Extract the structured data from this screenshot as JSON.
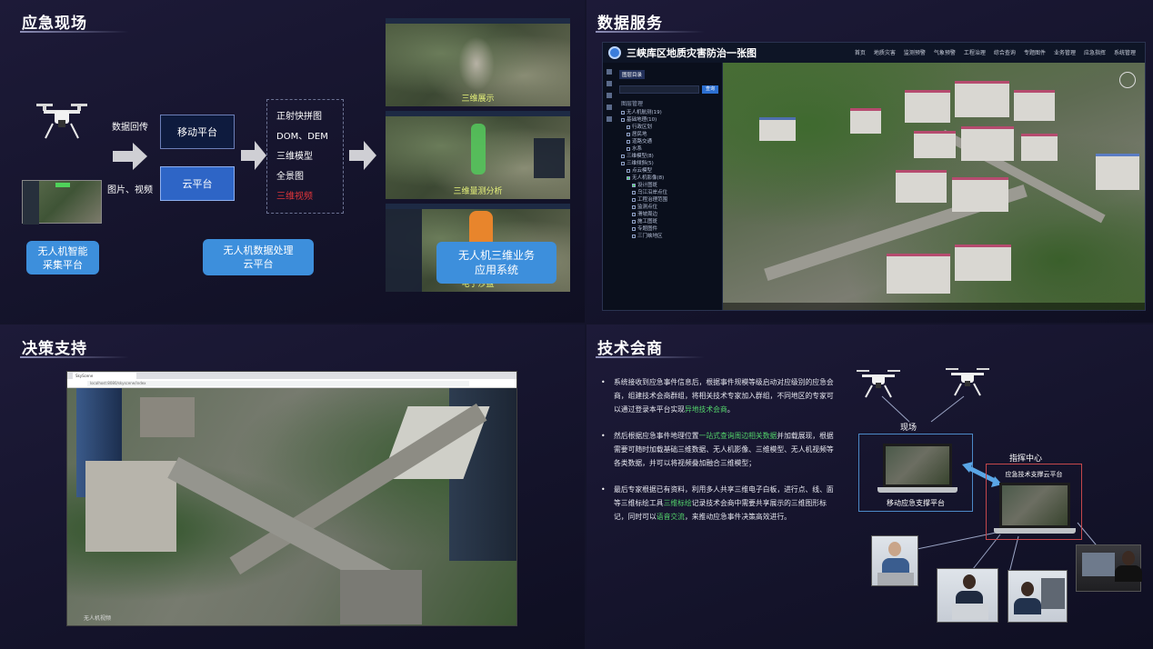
{
  "quadrants": {
    "emergency_scene": {
      "title": "应急现场",
      "labels": {
        "data_return": "数据回传",
        "image_video": "图片、视频"
      },
      "boxes": {
        "mobile_platform": "移动平台",
        "cloud_platform": "云平台"
      },
      "uav_collect": [
        "无人机智能",
        "采集平台"
      ],
      "uav_processing": [
        "无人机数据处理",
        "云平台"
      ],
      "products": [
        "正射快拼图",
        "DOM、DEM",
        "三维模型",
        "全景图",
        "三维视频"
      ],
      "screenshot_captions": [
        "三维展示",
        "三维量测分析",
        "电子沙盘"
      ],
      "uav_3d_app": [
        "无人机三维业务",
        "应用系统"
      ]
    },
    "data_service": {
      "title": "数据服务",
      "app_title": "三峡库区地质灾害防治一张图",
      "nav": [
        "首页",
        "地质灾害",
        "监测预警",
        "气象预警",
        "工程治理",
        "综合查询",
        "专题图件",
        "业务管理",
        "应急指挥",
        "系统管理"
      ],
      "panel_tab": "图层目录",
      "search_button": "查询",
      "tree_title": "图层管理",
      "tree": [
        "无人机航测(19)",
        "基础地理(10)",
        "行政区划",
        "居民地",
        "道路交通",
        "水系",
        "三维模型(8)",
        "三维倾斜(5)",
        "点云模型",
        "无人机影像(8)",
        "设计图斑",
        "乌江沿岸点位",
        "工程治理范围",
        "监测点位",
        "滑坡周边",
        "施工图斑",
        "专题图件",
        "三门峡地区"
      ]
    },
    "decision_support": {
      "title": "决策支持",
      "browser_tab": "SkyScene",
      "url": "localhost:8080/skyscene/index",
      "footer": "无人机视频"
    },
    "tech_consultation": {
      "title": "技术会商",
      "bullets": [
        [
          {
            "t": "系统接收到应急事件信息后，根据事件规模等级启动对应级别的应急会商，组建技术会商群组，将相关技术专家加入群组，不同地区的专家可以通过登录本平台实现",
            "g": false
          },
          {
            "t": "异地技术会商",
            "g": true
          },
          {
            "t": "。",
            "g": false
          }
        ],
        [
          {
            "t": "然后根据应急事件地理位置",
            "g": false
          },
          {
            "t": "一站式查询周边相关数据",
            "g": true
          },
          {
            "t": "并加载展现，根据需要可随时加载基础三维数据、无人机影像、三维模型、无人机视频等各类数据，并可以将视频叠加融合三维模型；",
            "g": false
          }
        ],
        [
          {
            "t": "最后专家根据已有资料，利用多人共享三维电子白板，进行点、线、面等三维标绘工具",
            "g": false
          },
          {
            "t": "三维标绘",
            "g": true
          },
          {
            "t": "记录技术会商中需要共享展示的三维图形标记，同时可以",
            "g": false
          },
          {
            "t": "语音交流",
            "g": true
          },
          {
            "t": "，来推动应急事件决策高效进行。",
            "g": false
          }
        ]
      ],
      "scene_label": "现场",
      "mobile_support": "移动应急支撑平台",
      "command_center": "指挥中心",
      "cloud_support": "应急技术支撑云平台"
    }
  },
  "colors": {
    "background": "#15142c",
    "accent_blue": "#3d8fdc",
    "highlight_green": "#53d46b",
    "alert_red": "#e0353a",
    "caption_yellow": "#e6f27a"
  }
}
